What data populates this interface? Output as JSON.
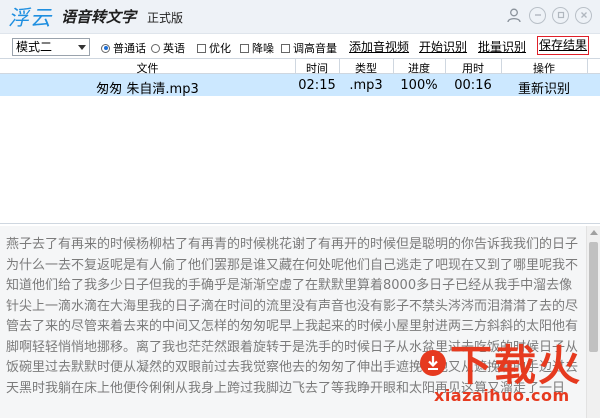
{
  "titlebar": {
    "logo": "浮云",
    "title": "语音转文字",
    "edition": "正式版",
    "icons": [
      "user-icon",
      "minimize-icon",
      "restore-icon",
      "close-icon"
    ]
  },
  "toolbar": {
    "mode_value": "模式二",
    "lang_mandarin": "普通话",
    "lang_english": "英语",
    "opt_optimize": "优化",
    "opt_denoise": "降噪",
    "opt_volume": "调高音量",
    "add_file": "添加音视频",
    "start": "开始识别",
    "batch": "批量识别",
    "save": "保存结果"
  },
  "table": {
    "columns": [
      "文件",
      "时间",
      "类型",
      "进度",
      "用时",
      "操作"
    ],
    "rows": [
      {
        "file": "匆匆 朱自清.mp3",
        "time": "02:15",
        "type": ".mp3",
        "progress": "100%",
        "elapsed": "00:16",
        "action": "重新识别"
      }
    ]
  },
  "result_text": "燕子去了有再来的时候杨柳枯了有再青的时候桃花谢了有再开的时候但是聪明的你告诉我我们的日子为什么一去不复返呢是有人偷了他们罢那是谁又藏在何处呢他们自己逃走了吧现在又到了哪里呢我不知道他们给了我多少日子但我的手确乎是渐渐空虚了在默默里算着8000多日子已经从我手中溜去像针尖上一滴水滴在大海里我的日子滴在时间的流里没有声音也没有影子不禁头涔涔而泪潸潸了去的尽管去了来的尽管来着去来的中间又怎样的匆匆呢早上我起来的时候小屋里射进两三方斜斜的太阳他有脚啊轻轻悄悄地挪移。离了我也茫茫然跟着旋转于是洗手的时候日子从水盆里过去吃饭的时候日子从饭碗里过去默默时便从凝然的双眼前过去我觉察他去的匆匆了伸出手遮挽时他又从遮挽着的手边过去天黑时我躺在床上他便伶俐俐从我身上跨过我脚边飞去了等我睁开眼和太阳再见这算又溜走了一日",
  "watermark": {
    "brand": "下载火",
    "domain": "xiazaihuo.com"
  },
  "colors": {
    "accent": "#1f8fe0",
    "selected_row": "#cce8ff",
    "save_border": "#e0202a",
    "watermark": "#e63a1f"
  }
}
